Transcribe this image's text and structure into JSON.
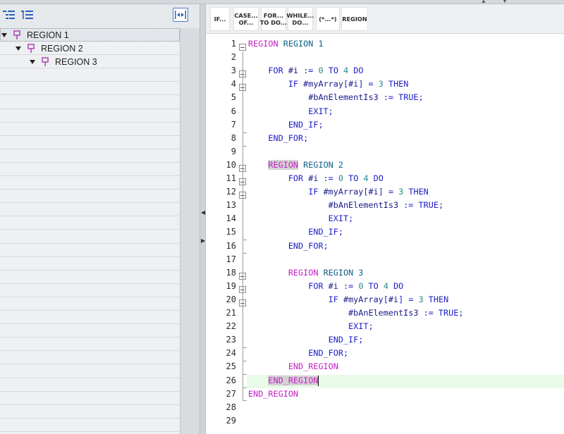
{
  "tree": {
    "items": [
      {
        "label": "REGION 1",
        "level": 0,
        "selected": true
      },
      {
        "label": "REGION 2",
        "level": 1,
        "selected": false
      },
      {
        "label": "REGION 3",
        "level": 2,
        "selected": false
      }
    ]
  },
  "left_toolbar": {
    "buttons": [
      "collapse-all-icon",
      "expand-all-icon",
      "sync-icon"
    ]
  },
  "snippets": [
    {
      "label": "IF..."
    },
    {
      "label": "CASE...\nOF..."
    },
    {
      "label": "FOR...\nTO DO..."
    },
    {
      "label": "WHILE...\nDO..."
    },
    {
      "label": "(*...*)"
    },
    {
      "label": "REGION"
    }
  ],
  "colors": {
    "keyword": "#1e21c6",
    "region_keyword": "#c41fc4",
    "region_name": "#0e5f8a",
    "current_line": "#eafbe9"
  },
  "editor": {
    "current_line": 26,
    "lines": [
      "REGION REGION 1",
      "",
      "    FOR #i := 0 TO 4 DO",
      "        IF #myArray[#i] = 3 THEN",
      "            #bAnElementIs3 := TRUE;",
      "            EXIT;",
      "        END_IF;",
      "    END_FOR;",
      "",
      "    REGION REGION 2",
      "        FOR #i := 0 TO 4 DO",
      "            IF #myArray[#i] = 3 THEN",
      "                #bAnElementIs3 := TRUE;",
      "                EXIT;",
      "            END_IF;",
      "        END_FOR;",
      "",
      "        REGION REGION 3",
      "            FOR #i := 0 TO 4 DO",
      "                IF #myArray[#i] = 3 THEN",
      "                    #bAnElementIs3 := TRUE;",
      "                    EXIT;",
      "                END_IF;",
      "            END_FOR;",
      "        END_REGION",
      "    END_REGION",
      "END_REGION",
      "",
      ""
    ]
  }
}
